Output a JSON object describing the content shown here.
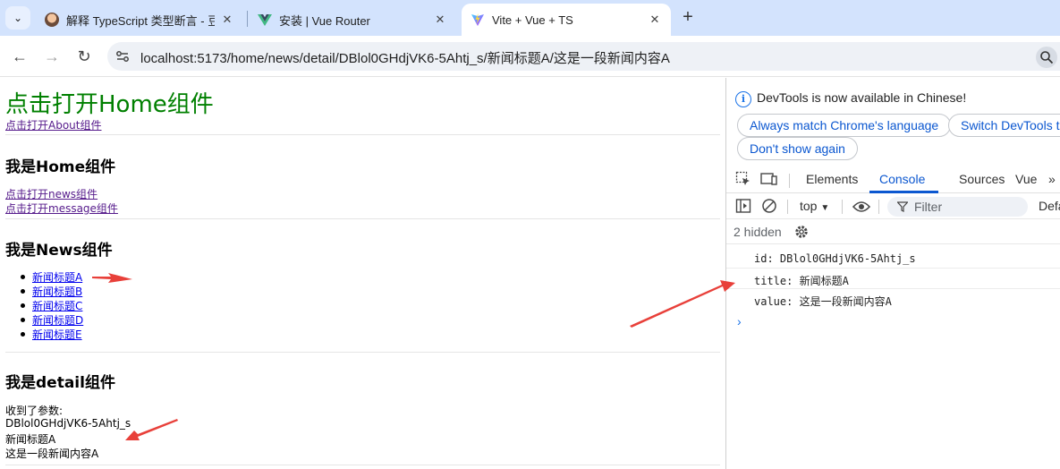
{
  "browser": {
    "tabs": [
      {
        "title": "解释 TypeScript 类型断言 - 豆包",
        "active": false
      },
      {
        "title": "安装 | Vue Router",
        "active": false
      },
      {
        "title": "Vite + Vue + TS",
        "active": true
      }
    ],
    "url": "localhost:5173/home/news/detail/DBlol0GHdjVK6-5Ahtj_s/新闻标题A/这是一段新闻内容A"
  },
  "page": {
    "home_heading": "点击打开Home组件",
    "about_link": "点击打开About组件",
    "home_title": "我是Home组件",
    "news_link": "点击打开news组件",
    "message_link": "点击打开message组件",
    "news_title": "我是News组件",
    "news_items": [
      "新闻标题A",
      "新闻标题B",
      "新闻标题C",
      "新闻标题D",
      "新闻标题E"
    ],
    "detail_title": "我是detail组件",
    "params_label": "收到了参数:",
    "param_id": "DBlol0GHdjVK6-5Ahtj_s",
    "param_title": "新闻标题A",
    "param_value": "这是一段新闻内容A"
  },
  "devtools": {
    "banner": "DevTools is now available in Chinese!",
    "btn_match": "Always match Chrome's language",
    "btn_switch": "Switch DevTools to Chinese",
    "btn_dont_show": "Don't show again",
    "tabs": [
      "Elements",
      "Console",
      "Sources",
      "Vue"
    ],
    "active_tab": "Console",
    "context": "top",
    "filter_placeholder": "Filter",
    "levels": "Default levels",
    "hidden": "2 hidden",
    "logs": [
      "id: DBlol0GHdjVK6-5Ahtj_s",
      "title: 新闻标题A",
      "value: 这是一段新闻内容A"
    ]
  },
  "colors": {
    "home_heading": "#008000",
    "annotation_arrow": "#e8403a",
    "accent": "#0b57d0"
  }
}
